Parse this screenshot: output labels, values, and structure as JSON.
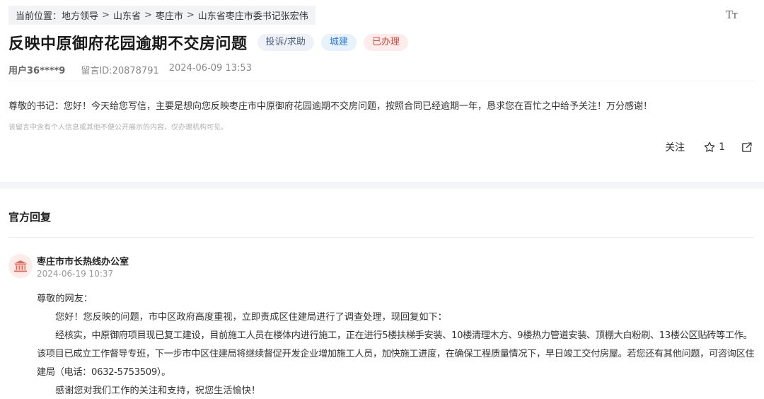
{
  "breadcrumb": {
    "prefix": "当前位置：",
    "items": [
      "地方领导",
      "山东省",
      "枣庄市",
      "山东省枣庄市委书记张宏伟"
    ],
    "separator": ">"
  },
  "font_size_label": "Tт",
  "post": {
    "title": "反映中原御府花园逾期不交房问题",
    "tags": {
      "type": "投诉/求助",
      "category": "城建",
      "status": "已办理"
    },
    "user": "用户36****9",
    "message_id": "留言ID:20878791",
    "time": "2024-06-09 13:53",
    "content": "尊敬的书记：您好！今天给您写信，主要是想向您反映枣庄市中原御府花园逾期不交房问题，按照合同已经逾期一年，恳求您在百忙之中给予关注！万分感谢！",
    "privacy_notice": "该留言中含有个人信息或其他不便公开展示的内容，仅办理机构可见。"
  },
  "actions": {
    "follow_label": "关注",
    "like_count": "1"
  },
  "reply": {
    "section_title": "官方回复",
    "office": "枣庄市市长热线办公室",
    "time": "2024-06-19 10:37",
    "greeting": "尊敬的网友：",
    "p1": "您好！您反映的问题，市中区政府高度重视，立即责成区住建局进行了调查处理，现回复如下：",
    "p2": "经核实，中原御府项目现已复工建设，目前施工人员在楼体内进行施工，正在进行5楼扶梯手安装、10楼清理木方、9楼热力管道安装、顶棚大白粉刷、13楼公区贴砖等工作。该项目已成立工作督导专班，下一步市中区住建局将继续督促开发企业增加施工人员，加快施工进度，在确保工程质量情况下，早日竣工交付房屋。若您还有其他问题，可咨询区住建局（电话：0632-5753509）。",
    "p3": "感谢您对我们工作的关注和支持，祝您生活愉快！"
  },
  "colors": {
    "accent_blue": "#2d7be0",
    "status_red": "#e0493a",
    "avatar_red": "#e06a5a"
  }
}
